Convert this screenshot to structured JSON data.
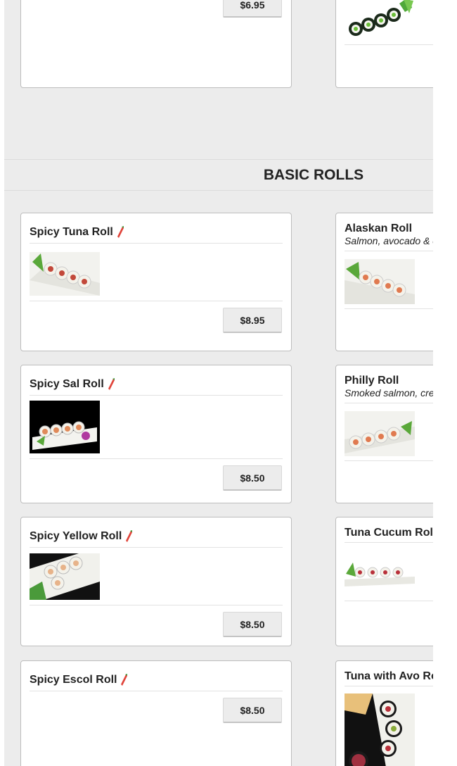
{
  "top_cards": {
    "left": {
      "price": "$6.95"
    },
    "right": {
      "image": "cucumber-roll-photo"
    }
  },
  "section": {
    "title": "BASIC ROLLS"
  },
  "left_items": [
    {
      "name": "Spicy Tuna Roll",
      "spicy": true,
      "price": "$8.95",
      "image": "spicy-tuna-roll-photo"
    },
    {
      "name": "Spicy Sal Roll",
      "spicy": true,
      "price": "$8.50",
      "image": "spicy-salmon-roll-photo"
    },
    {
      "name": "Spicy Yellow Roll",
      "spicy": true,
      "price": "$8.50",
      "image": "spicy-yellowtail-roll-photo"
    },
    {
      "name": "Spicy Escol Roll",
      "spicy": true,
      "price": "$8.50",
      "image": ""
    }
  ],
  "right_items": [
    {
      "name": "Alaskan Roll",
      "description": "Salmon, avocado & c",
      "image": "alaskan-roll-photo"
    },
    {
      "name": "Philly Roll",
      "description": "Smoked salmon, crea",
      "image": "philly-roll-photo"
    },
    {
      "name": "Tuna Cucum Roll",
      "description": "",
      "image": "tuna-cucumber-roll-photo"
    },
    {
      "name": "Tuna with Avo Ro",
      "description": "",
      "image": "tuna-avocado-roll-photo"
    }
  ],
  "colors": {
    "page_bg": "#ececec",
    "card_bg": "#ffffff",
    "chili_red": "#e0443a"
  }
}
